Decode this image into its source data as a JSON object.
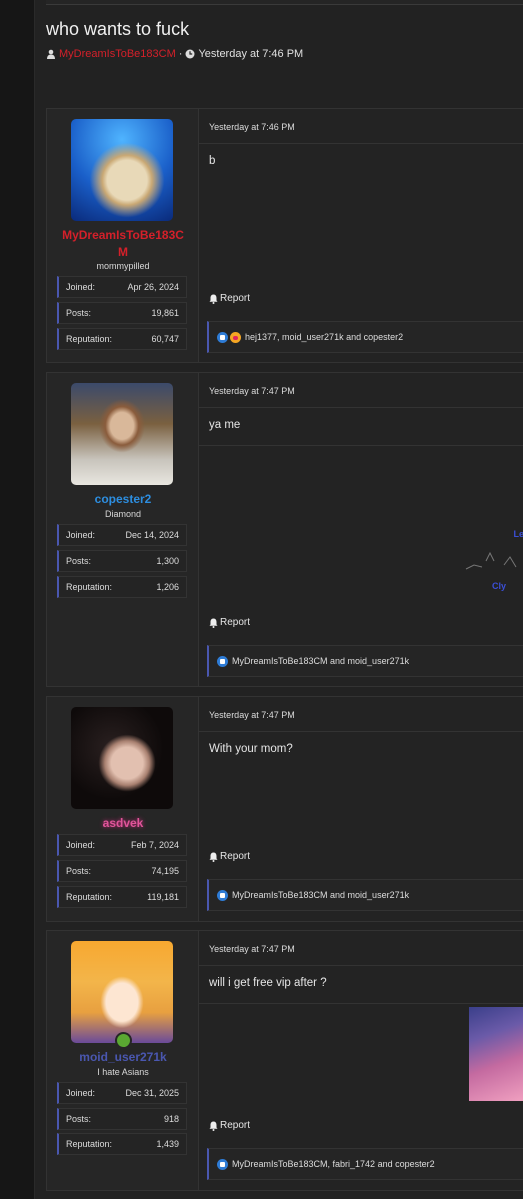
{
  "thread": {
    "title": "who wants to fuck",
    "author": "MyDreamIsToBe183CM",
    "separator": "·",
    "date": "Yesterday at 7:46 PM"
  },
  "labels": {
    "joined": "Joined:",
    "posts": "Posts:",
    "reputation": "Reputation:",
    "report": "Report"
  },
  "posts": [
    {
      "username_line1": "MyDreamIsToBe183C",
      "username_line2": "M",
      "user_title": "mommypilled",
      "joined": "Apr 26, 2024",
      "posts": "19,861",
      "reputation": "60,747",
      "date": "Yesterday at 7:46 PM",
      "message": "b",
      "reactions": "hej1377, moid_user271k and copester2",
      "username_color": "#d4202a"
    },
    {
      "username": "copester2",
      "user_title": "Diamond",
      "joined": "Dec 14, 2024",
      "posts": "1,300",
      "reputation": "1,206",
      "date": "Yesterday at 7:47 PM",
      "message": "ya me",
      "signature_line1": "Le",
      "signature_line2": "Cly",
      "reactions": "MyDreamIsToBe183CM and moid_user271k",
      "username_color": "#2d8ee0"
    },
    {
      "username": "asdvek",
      "joined": "Feb 7, 2024",
      "posts": "74,195",
      "reputation": "119,181",
      "date": "Yesterday at 7:47 PM",
      "message": "With your mom?",
      "reactions": "MyDreamIsToBe183CM and moid_user271k",
      "username_color": "#e0559a"
    },
    {
      "username": "moid_user271k",
      "user_title": "I hate Asians",
      "joined": "Dec 31, 2025",
      "posts": "918",
      "reputation": "1,439",
      "date": "Yesterday at 7:47 PM",
      "message": "will i get free vip after ?",
      "reactions": "MyDreamIsToBe183CM, fabri_1742 and copester2",
      "username_color": "#4a57b0"
    }
  ]
}
